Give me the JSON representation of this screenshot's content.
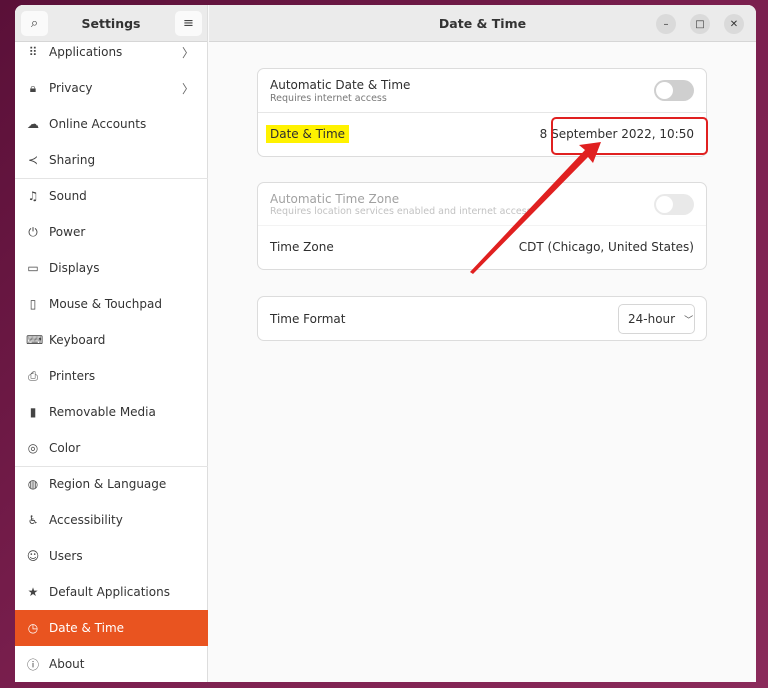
{
  "sidebar": {
    "title": "Settings",
    "items": [
      {
        "label": "Applications",
        "icon": "apps-grid-icon",
        "glyph": "⠿",
        "chev": true
      },
      {
        "label": "Privacy",
        "icon": "lock-icon",
        "glyph": "🔒︎",
        "chev": true
      },
      {
        "label": "Online Accounts",
        "icon": "cloud-icon",
        "glyph": "☁"
      },
      {
        "label": "Sharing",
        "icon": "share-icon",
        "glyph": "≺"
      },
      {
        "label": "Sound",
        "icon": "music-note-icon",
        "glyph": "♫"
      },
      {
        "label": "Power",
        "icon": "power-icon",
        "glyph": "⏻"
      },
      {
        "label": "Displays",
        "icon": "display-icon",
        "glyph": "▭"
      },
      {
        "label": "Mouse & Touchpad",
        "icon": "mouse-icon",
        "glyph": "▯"
      },
      {
        "label": "Keyboard",
        "icon": "keyboard-icon",
        "glyph": "⌨"
      },
      {
        "label": "Printers",
        "icon": "printer-icon",
        "glyph": "⎙"
      },
      {
        "label": "Removable Media",
        "icon": "removable-media-icon",
        "glyph": "▮"
      },
      {
        "label": "Color",
        "icon": "color-icon",
        "glyph": "◎"
      },
      {
        "label": "Region & Language",
        "icon": "globe-icon",
        "glyph": "◍"
      },
      {
        "label": "Accessibility",
        "icon": "accessibility-icon",
        "glyph": "♿︎"
      },
      {
        "label": "Users",
        "icon": "users-icon",
        "glyph": "☺"
      },
      {
        "label": "Default Applications",
        "icon": "star-icon",
        "glyph": "★"
      },
      {
        "label": "Date & Time",
        "icon": "clock-icon",
        "glyph": "◷",
        "active": true
      },
      {
        "label": "About",
        "icon": "info-icon",
        "glyph": "ⓘ"
      }
    ]
  },
  "header": {
    "title": "Date & Time",
    "menu_glyph": "≡",
    "search_glyph": "⌕"
  },
  "window_controls": {
    "minimize": "–",
    "maximize": "□",
    "close": "✕"
  },
  "main": {
    "auto_datetime": {
      "label": "Automatic Date & Time",
      "sublabel": "Requires internet access",
      "enabled": false
    },
    "datetime": {
      "label": "Date & Time",
      "value": "8 September 2022, 10:50"
    },
    "auto_timezone": {
      "label": "Automatic Time Zone",
      "sublabel": "Requires location services enabled and internet access",
      "enabled": false,
      "disabled": true
    },
    "timezone": {
      "label": "Time Zone",
      "value": "CDT (Chicago, United States)"
    },
    "time_format": {
      "label": "Time Format",
      "value": "24-hour"
    }
  },
  "annotation_colors": {
    "highlight": "#fff200",
    "box": "#e02020",
    "arrow": "#e02020",
    "accent": "#e95420"
  }
}
